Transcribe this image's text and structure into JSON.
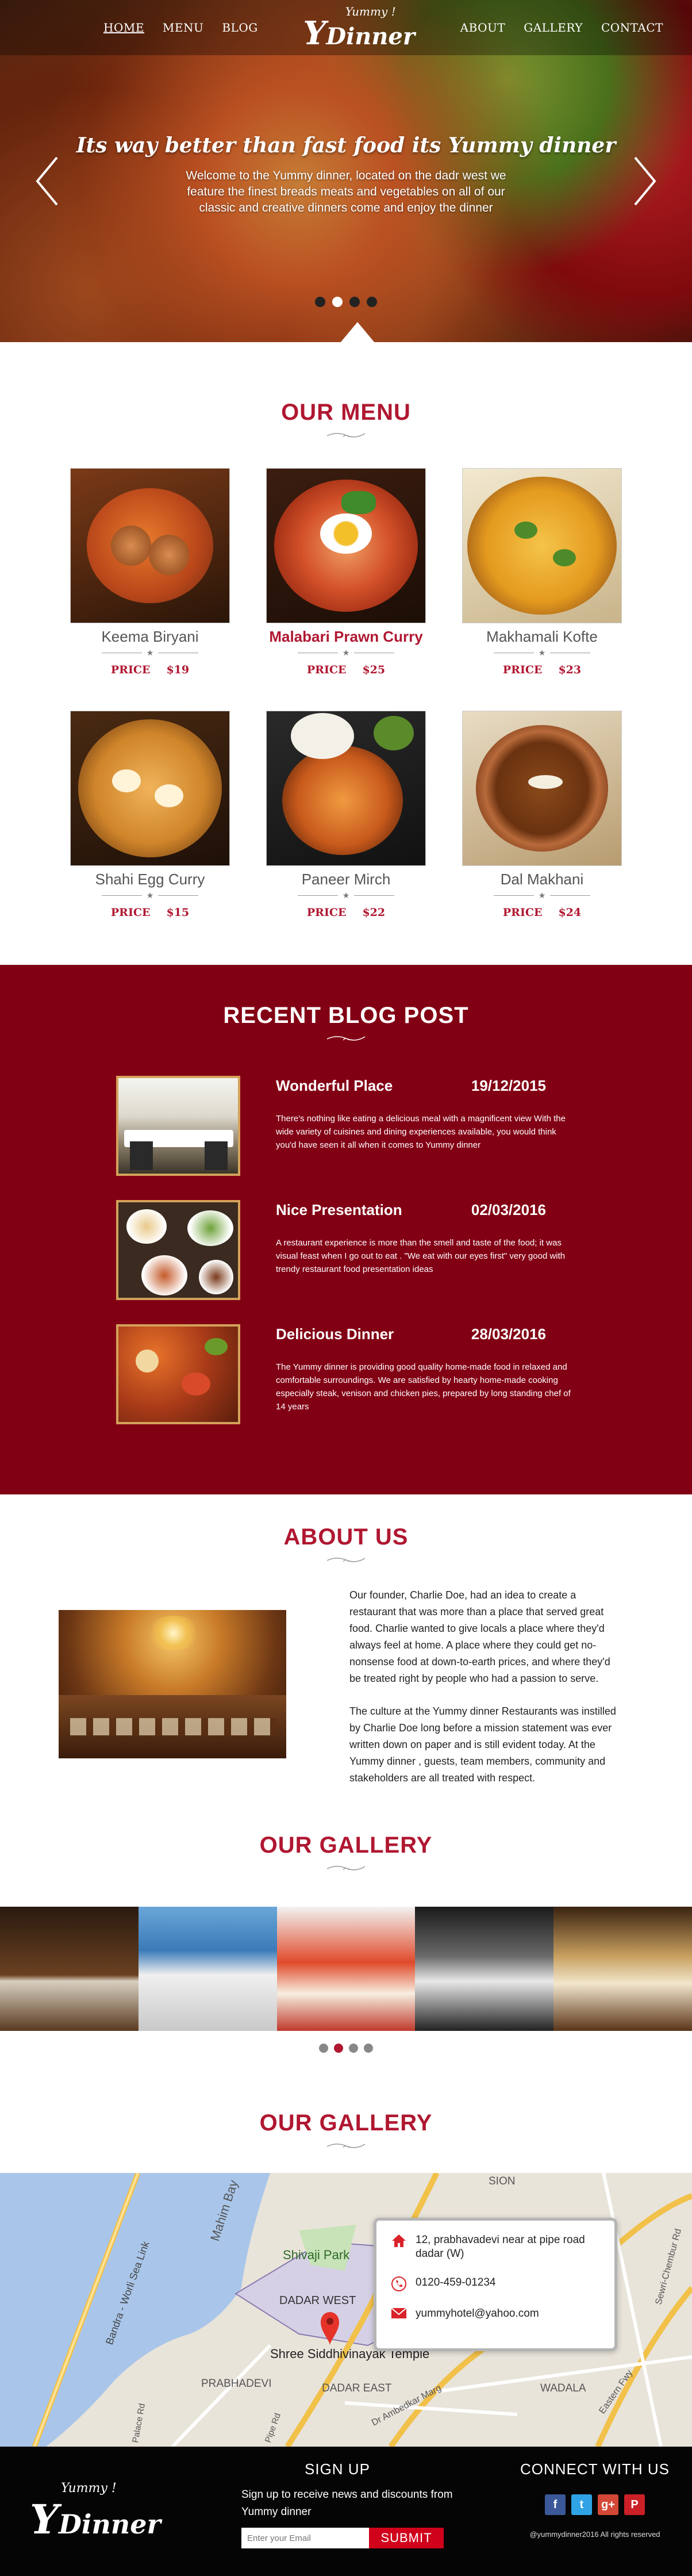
{
  "nav": {
    "left": [
      "HOME",
      "MENU",
      "BLOG"
    ],
    "right": [
      "ABOUT",
      "GALLERY",
      "CONTACT"
    ],
    "logo_top": "Yummy !",
    "logo_y": "Y",
    "logo_main": "Dinner"
  },
  "hero": {
    "title": "Its way better than fast food its Yummy dinner",
    "text": "Welcome to the Yummy dinner, located on the dadr west we feature the finest breads meats and vegetables on all of our classic and creative dinners come and enjoy the dinner",
    "slides": 4,
    "active_slide": 1
  },
  "menu": {
    "title": "OUR MENU",
    "price_label": "PRICE",
    "items": [
      {
        "name": "Keema Biryani",
        "price": "$19",
        "featured": false
      },
      {
        "name": "Malabari Prawn Curry",
        "price": "$25",
        "featured": true
      },
      {
        "name": "Makhamali Kofte",
        "price": "$23",
        "featured": false
      },
      {
        "name": "Shahi Egg Curry",
        "price": "$15",
        "featured": false
      },
      {
        "name": "Paneer Mirch",
        "price": "$22",
        "featured": false
      },
      {
        "name": "Dal Makhani",
        "price": "$24",
        "featured": false
      }
    ]
  },
  "blog": {
    "title": "RECENT BLOG POST",
    "posts": [
      {
        "title": "Wonderful Place",
        "date": "19/12/2015",
        "text": "There's nothing like eating a delicious meal with a magnificent view With the wide variety of cuisines and dining experiences available, you would think you'd have seen it all when it comes to Yummy dinner"
      },
      {
        "title": "Nice Presentation",
        "date": "02/03/2016",
        "text": "A restaurant experience is more than the smell and taste of the food; it was visual feast when I go out to eat . \"We eat with our eyes first\" very good with trendy restaurant food presentation ideas"
      },
      {
        "title": "Delicious Dinner",
        "date": "28/03/2016",
        "text": "The Yummy dinner is providing good quality home-made food in relaxed and comfortable surroundings. We are satisfied by hearty home-made cooking especially steak, venison and chicken pies, prepared by long standing chef of 14 years"
      }
    ]
  },
  "about": {
    "title": "ABOUT US",
    "p1": "Our founder, Charlie Doe, had an idea to create a restaurant that was more than a place that served great food. Charlie wanted to give locals a place where they'd always feel at home. A place where they could get no-nonsense food at down-to-earth prices, and where they'd be treated right by people who had a passion to serve.",
    "p2": "The culture at the Yummy dinner Restaurants was instilled by Charlie Doe long before a mission statement was ever written down on paper and is still evident today. At the Yummy dinner , guests, team members, community and stakeholders are all treated with respect."
  },
  "gallery": {
    "title": "OUR GALLERY",
    "slides": 4,
    "active_slide": 1
  },
  "map": {
    "title": "OUR GALLERY",
    "labels": [
      "Mahim Bay",
      "Shivaji Park",
      "DADAR WEST",
      "Shree Siddhivinayak Temple",
      "PRABHADEVI",
      "DADAR EAST",
      "WADALA",
      "SION",
      "Bandra - Worli Sea Link",
      "Sewri-Chembur Rd",
      "Eastern Fwy",
      "Dr Ambedkar Marg",
      "Pipe Rd",
      "Palace Rd"
    ],
    "address": "12, prabhavadevi near at pipe road dadar (W)",
    "phone": "0120-459-01234",
    "email": "yummyhotel@yahoo.com"
  },
  "footer": {
    "logo_top": "Yummy !",
    "logo_y": "Y",
    "logo_main": "Dinner",
    "signup_title": "SIGN UP",
    "signup_text": "Sign up to receive news and discounts from Yummy dinner",
    "email_placeholder": "Enter your Email",
    "submit_label": "SUBMIT",
    "connect_title": "CONNECT WITH US",
    "copyright": "@yummydinner2016 All rights reserved"
  },
  "colors": {
    "brand": "#b01731",
    "blog_bg": "#820014",
    "footer_bg": "#050505",
    "submit_bg": "#d0021b"
  }
}
